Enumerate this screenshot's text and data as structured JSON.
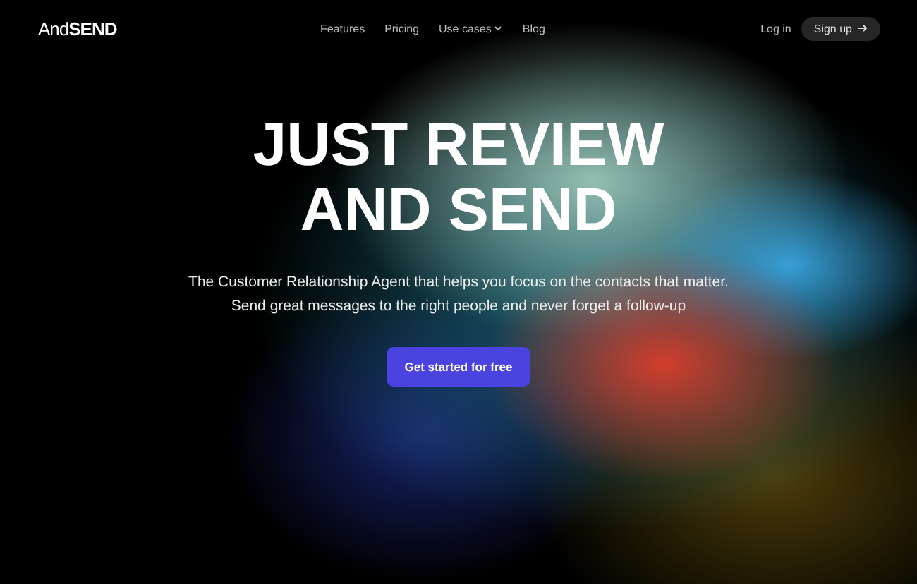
{
  "logo": {
    "light": "And",
    "bold": "SEND"
  },
  "nav": [
    {
      "label": "Features",
      "kind": "link"
    },
    {
      "label": "Pricing",
      "kind": "link"
    },
    {
      "label": "Use cases",
      "kind": "dropdown"
    },
    {
      "label": "Blog",
      "kind": "link"
    }
  ],
  "login": "Log in",
  "signup": "Sign up",
  "hero": {
    "title_lines": [
      "JUST REVIEW",
      "AND SEND"
    ],
    "subtitle_lines": [
      "The Customer Relationship Agent that helps you focus on the contacts that matter.",
      "Send great messages to the right people and never forget a follow-up"
    ],
    "cta": "Get started for free"
  }
}
